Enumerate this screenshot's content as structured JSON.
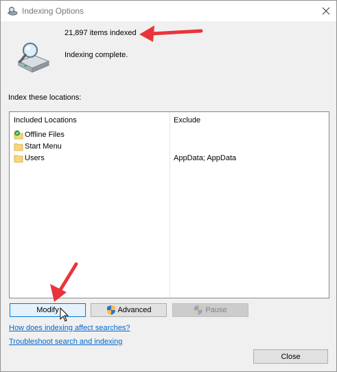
{
  "window": {
    "title": "Indexing Options",
    "close_icon": "close-icon"
  },
  "status": {
    "items_indexed": "21,897 items indexed",
    "state": "Indexing complete."
  },
  "locations": {
    "label": "Index these locations:",
    "columns": [
      "Included Locations",
      "Exclude"
    ],
    "rows": [
      {
        "name": "Offline Files",
        "exclude": "",
        "icon": "offline-files-icon"
      },
      {
        "name": "Start Menu",
        "exclude": "",
        "icon": "folder-icon"
      },
      {
        "name": "Users",
        "exclude": "AppData; AppData",
        "icon": "folder-icon"
      }
    ]
  },
  "buttons": {
    "modify": "Modify",
    "advanced": "Advanced",
    "pause": "Pause",
    "close": "Close"
  },
  "links": {
    "how_affects": "How does indexing affect searches?",
    "troubleshoot": "Troubleshoot search and indexing"
  },
  "colors": {
    "annotation_arrow": "#e8353b",
    "link": "#0066cc",
    "focus_border": "#0078d7"
  }
}
